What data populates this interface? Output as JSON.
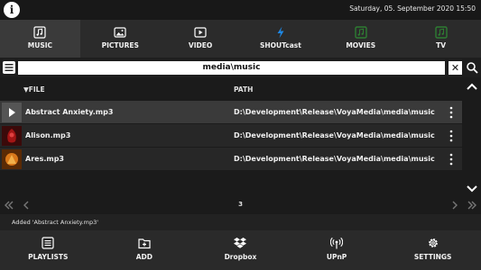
{
  "topbar": {
    "info_icon": "info-icon",
    "datetime": "Saturday, 05. September 2020 15:50"
  },
  "tabs": [
    {
      "label": "MUSIC",
      "icon": "music-icon",
      "active": true
    },
    {
      "label": "PICTURES",
      "icon": "pictures-icon",
      "active": false
    },
    {
      "label": "VIDEO",
      "icon": "video-icon",
      "active": false
    },
    {
      "label": "SHOUTcast",
      "icon": "shoutcast-icon",
      "active": false
    },
    {
      "label": "MOVIES",
      "icon": "movies-icon",
      "active": false
    },
    {
      "label": "TV",
      "icon": "tv-icon",
      "active": false
    }
  ],
  "pathbar": {
    "value": "media\\music",
    "clear_label": "✕"
  },
  "table": {
    "columns": {
      "file": "▼FILE",
      "path": "PATH"
    },
    "rows": [
      {
        "file": "Abstract Anxiety.mp3",
        "path": "D:\\Development\\Release\\VoyaMedia\\media\\music",
        "thumb": "play-thumb",
        "selected": true
      },
      {
        "file": "Alison.mp3",
        "path": "D:\\Development\\Release\\VoyaMedia\\media\\music",
        "thumb": "album-art-red",
        "selected": false
      },
      {
        "file": "Ares.mp3",
        "path": "D:\\Development\\Release\\VoyaMedia\\media\\music",
        "thumb": "album-art-orange",
        "selected": false
      }
    ]
  },
  "pager": {
    "page": "3"
  },
  "status": {
    "text": "Added 'Abstract Anxiety.mp3'"
  },
  "bottombar": [
    {
      "label": "PLAYLISTS",
      "icon": "playlist-icon"
    },
    {
      "label": "ADD",
      "icon": "add-folder-icon"
    },
    {
      "label": "Dropbox",
      "icon": "dropbox-icon"
    },
    {
      "label": "UPnP",
      "icon": "upnp-icon"
    },
    {
      "label": "SETTINGS",
      "icon": "gear-icon"
    }
  ],
  "colors": {
    "background": "#1b1b1b",
    "tab_bar": "#2b2b2b",
    "tab_active": "#3a3a3a",
    "row": "#272727",
    "row_selected": "#3a3a3a",
    "shoutcast_accent": "#1e88e5",
    "movies_tv_accent": "#2e7d32"
  }
}
